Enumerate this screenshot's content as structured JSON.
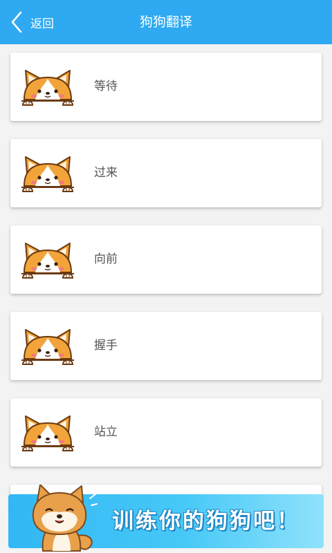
{
  "header": {
    "back_label": "返回",
    "title": "狗狗翻译",
    "color": "#2ea9f2"
  },
  "commands": [
    {
      "label": "等待",
      "icon": "corgi-icon"
    },
    {
      "label": "过来",
      "icon": "corgi-icon"
    },
    {
      "label": "向前",
      "icon": "corgi-icon"
    },
    {
      "label": "握手",
      "icon": "corgi-icon"
    },
    {
      "label": "站立",
      "icon": "corgi-icon"
    }
  ],
  "banner": {
    "text": "训练你的狗狗吧！",
    "icon": "shiba-dog-icon"
  }
}
